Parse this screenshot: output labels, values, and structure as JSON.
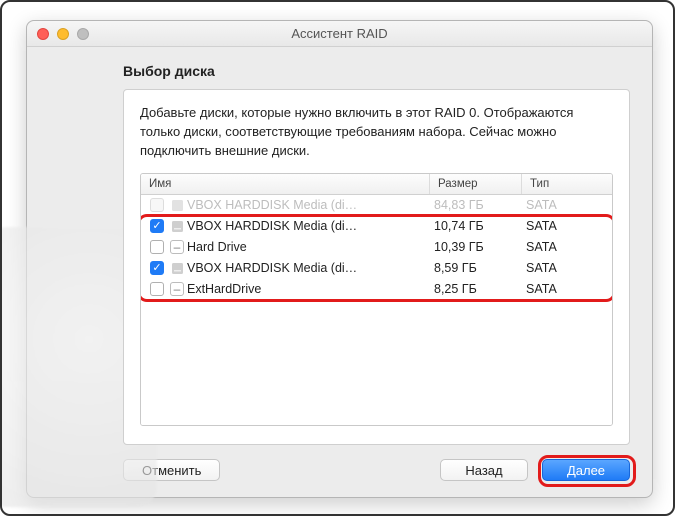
{
  "window": {
    "title": "Ассистент RAID"
  },
  "heading": "Выбор диска",
  "description": "Добавьте диски, которые нужно включить в этот RAID 0. Отображаются только диски, соответствующие требованиям набора. Сейчас можно подключить внешние диски.",
  "columns": {
    "name": "Имя",
    "size": "Размер",
    "type": "Тип"
  },
  "disks": [
    {
      "checked": false,
      "disabled": true,
      "icon": "hdd",
      "name": "VBOX HARDDISK Media (di…",
      "size": "84,83 ГБ",
      "type": "SATA"
    },
    {
      "checked": true,
      "disabled": false,
      "icon": "hdd",
      "name": "VBOX HARDDISK Media (di…",
      "size": "10,74 ГБ",
      "type": "SATA"
    },
    {
      "checked": false,
      "disabled": false,
      "icon": "dash",
      "name": "Hard Drive",
      "size": "10,39 ГБ",
      "type": "SATA"
    },
    {
      "checked": true,
      "disabled": false,
      "icon": "hdd",
      "name": "VBOX HARDDISK Media (di…",
      "size": "8,59 ГБ",
      "type": "SATA"
    },
    {
      "checked": false,
      "disabled": false,
      "icon": "dash",
      "name": "ExtHardDrive",
      "size": "8,25 ГБ",
      "type": "SATA"
    }
  ],
  "buttons": {
    "cancel": "Отменить",
    "back": "Назад",
    "next": "Далее"
  }
}
